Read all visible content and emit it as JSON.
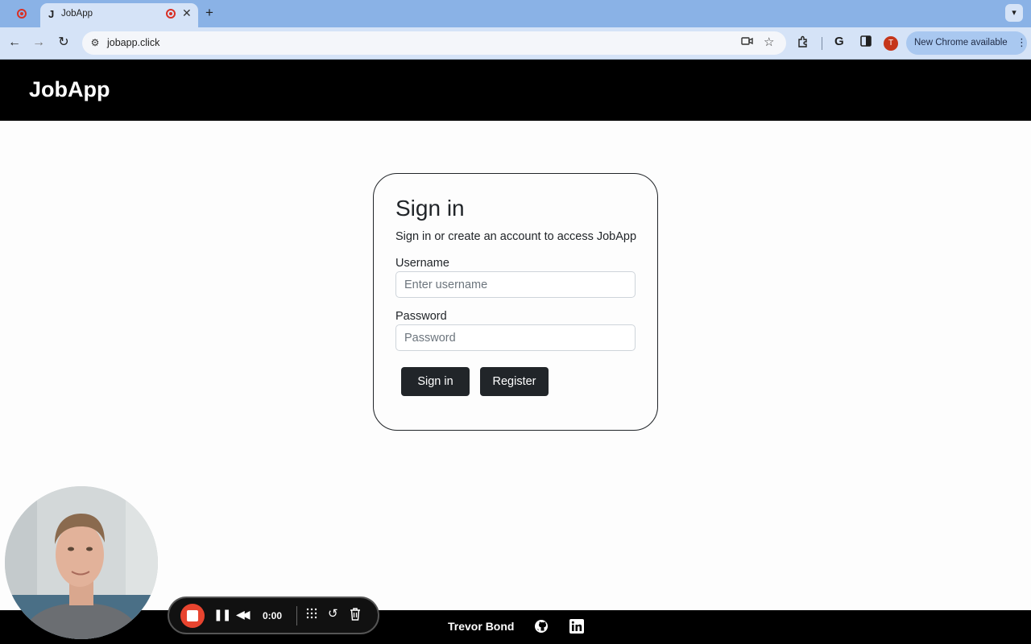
{
  "browser": {
    "tab_title": "JobApp",
    "tab_favicon": "J",
    "url": "jobapp.click",
    "profile_initial": "T",
    "update_label": "New Chrome available",
    "icons": [
      "record-icon",
      "close-icon",
      "plus-icon",
      "chevron-down-icon",
      "back-icon",
      "forward-icon",
      "reload-icon",
      "site-info-icon",
      "camera-icon",
      "star-icon",
      "extensions-icon",
      "google-icon",
      "side-panel-icon",
      "more-icon"
    ]
  },
  "app": {
    "brand": "JobApp"
  },
  "signin": {
    "title": "Sign in",
    "subtitle": "Sign in or create an account to access JobApp",
    "username_label": "Username",
    "username_placeholder": "Enter username",
    "username_value": "",
    "password_label": "Password",
    "password_placeholder": "Password",
    "password_value": "",
    "signin_button": "Sign in",
    "register_button": "Register"
  },
  "recorder": {
    "timer": "0:00",
    "presenter_name": "Trevor Bond",
    "icons": [
      "stop-icon",
      "pause-icon",
      "rewind-icon",
      "grid-icon",
      "restart-icon",
      "trash-icon",
      "github-icon",
      "linkedin-icon"
    ]
  },
  "colors": {
    "tabbar": "#8ab2e6",
    "toolbar": "#d5e3f7",
    "header": "#000000",
    "button": "#212529",
    "record": "#e8442f"
  }
}
